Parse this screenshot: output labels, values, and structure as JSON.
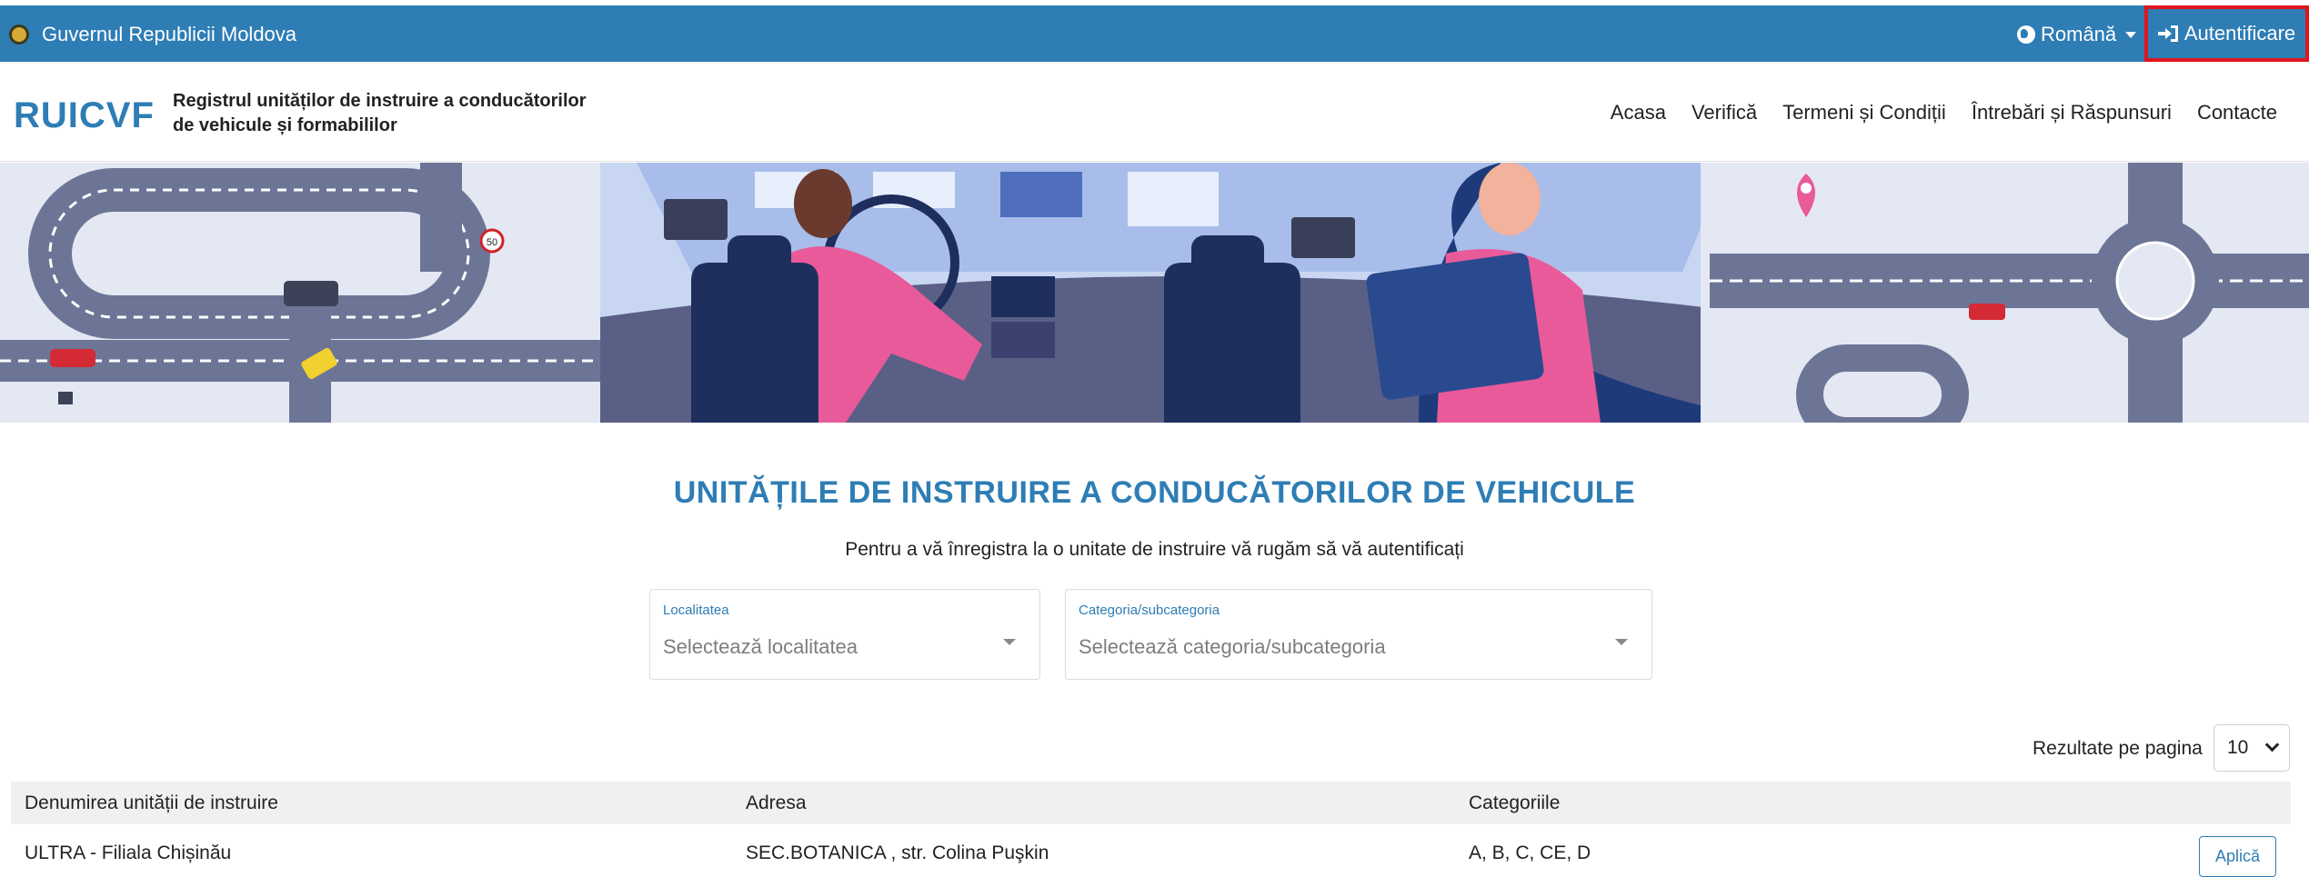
{
  "govbar": {
    "name": "Guvernul Republicii Moldova",
    "language": "Română",
    "login_label": "Autentificare"
  },
  "header": {
    "logo": "RUICVF",
    "subtitle_line1": "Registrul unităților de instruire a conducătorilor",
    "subtitle_line2": "de vehicule și formabililor",
    "nav": [
      "Acasa",
      "Verifică",
      "Termeni și Condiții",
      "Întrebări și Răspunsuri",
      "Contacte"
    ]
  },
  "banner": {
    "speed_sign": "50"
  },
  "main": {
    "title": "UNITĂȚILE DE INSTRUIRE A CONDUCĂTORILOR DE VEHICULE",
    "subtitle": "Pentru a vă înregistra la o unitate de instruire vă rugăm să vă autentificați",
    "filters": {
      "locality_label": "Localitatea",
      "locality_placeholder": "Selectează localitatea",
      "category_label": "Categoria/subcategoria",
      "category_placeholder": "Selectează categoria/subcategoria"
    },
    "per_page_label": "Rezultate pe pagina",
    "per_page_value": "10"
  },
  "table": {
    "columns": [
      "Denumirea unității de instruire",
      "Adresa",
      "Categoriile"
    ],
    "rows": [
      {
        "name": "ULTRA - Filiala Chișinău",
        "address": "SEC.BOTANICA , str. Colina Puşkin",
        "categories": "A, B, C, CE, D",
        "action": "Aplică"
      }
    ]
  },
  "colors": {
    "primary": "#2e7db5",
    "highlight_border": "#e0141e"
  }
}
